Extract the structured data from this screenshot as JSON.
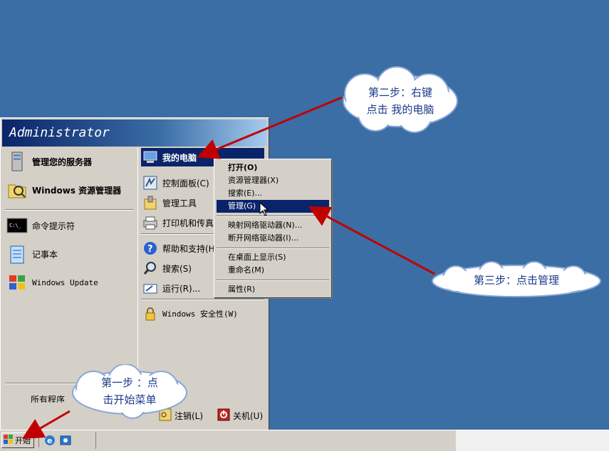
{
  "start_menu": {
    "user": "Administrator",
    "left_items": [
      {
        "label": "管理您的服务器",
        "icon": "server-icon"
      },
      {
        "label": "Windows 资源管理器",
        "icon": "folder-explorer-icon"
      },
      {
        "label": "命令提示符",
        "icon": "cmd-icon"
      },
      {
        "label": "记事本",
        "icon": "notepad-icon"
      },
      {
        "label": "Windows Update",
        "icon": "windows-update-icon"
      }
    ],
    "all_programs": "所有程序",
    "right_items": [
      {
        "label": "我的电脑",
        "icon": "my-computer-icon"
      },
      {
        "label": "控制面板(C)",
        "icon": "control-panel-icon"
      },
      {
        "label": "管理工具",
        "icon": "admin-tools-icon"
      },
      {
        "label": "打印机和传真",
        "icon": "printer-icon"
      },
      {
        "label": "帮助和支持(H)",
        "icon": "help-icon"
      },
      {
        "label": "搜索(S)",
        "icon": "search-icon"
      },
      {
        "label": "运行(R)...",
        "icon": "run-icon"
      },
      {
        "label": "Windows 安全性(W)",
        "icon": "security-icon"
      }
    ],
    "logoff": "注销(L)",
    "shutdown": "关机(U)"
  },
  "context_menu": {
    "items": [
      "打开(O)",
      "资源管理器(X)",
      "搜索(E)...",
      "管理(G)",
      "映射网络驱动器(N)...",
      "断开网络驱动器(I)...",
      "在桌面上显示(S)",
      "重命名(M)",
      "属性(R)"
    ]
  },
  "taskbar": {
    "start_label": "开始"
  },
  "annotations": {
    "step1": [
      "第一步 ：点",
      "击开始菜单"
    ],
    "step2": [
      "第二步：右键",
      "点击 我的电脑"
    ],
    "step3": "第三步：点击管理"
  },
  "colors": {
    "desktop": "#3a6ea5",
    "highlight": "#0a246a",
    "arrow": "#c00000"
  }
}
